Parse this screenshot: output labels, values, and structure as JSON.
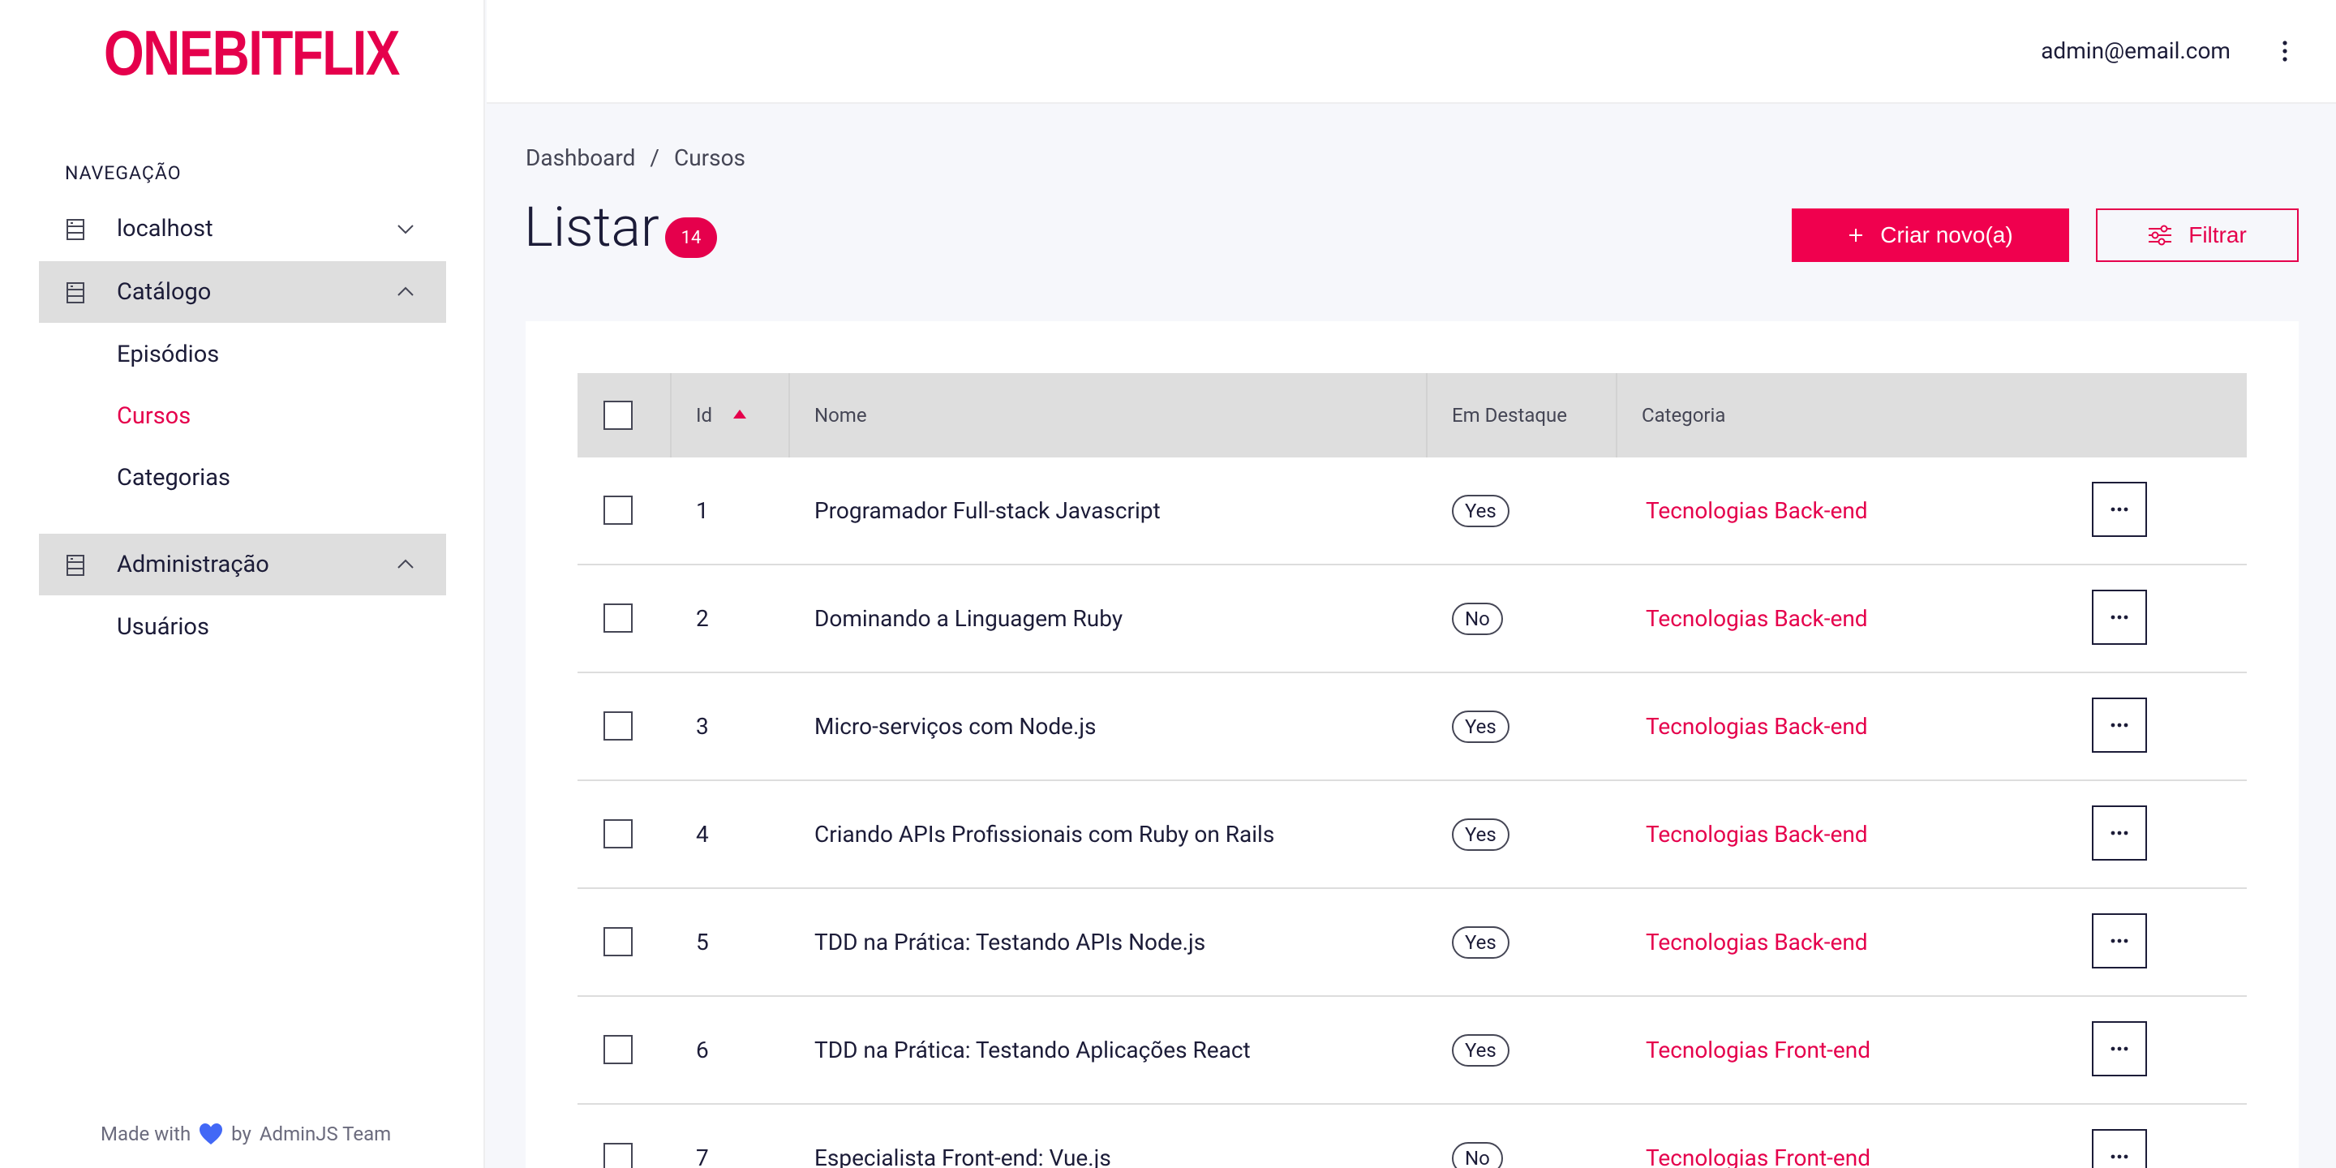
{
  "brand": {
    "logo_text": "ONEBITFLIX",
    "accent_color": "#e5004c"
  },
  "sidebar": {
    "heading": "NAVEGAÇÃO",
    "groups": [
      {
        "label": "localhost",
        "icon": "database-icon",
        "expanded": false,
        "items": []
      },
      {
        "label": "Catálogo",
        "icon": "database-icon",
        "expanded": true,
        "items": [
          "Episódios",
          "Cursos",
          "Categorias"
        ],
        "selected": "Cursos"
      },
      {
        "label": "Administração",
        "icon": "database-icon",
        "expanded": true,
        "items": [
          "Usuários"
        ]
      }
    ],
    "footer": {
      "made_with": "Made with",
      "by": "by",
      "team": "AdminJS Team",
      "heart_color": "#4268f6"
    }
  },
  "topbar": {
    "user_email": "admin@email.com"
  },
  "breadcrumb": [
    "Dashboard",
    "/",
    "Cursos"
  ],
  "page": {
    "title": "Listar",
    "count": "14"
  },
  "actions": {
    "create_label": "Criar novo(a)",
    "filter_label": "Filtrar"
  },
  "table": {
    "columns": {
      "id": "Id",
      "nome": "Nome",
      "destaque": "Em Destaque",
      "categoria": "Categoria"
    },
    "sort": {
      "column": "Id",
      "direction": "asc"
    },
    "rows": [
      {
        "id": "1",
        "nome": "Programador Full-stack Javascript",
        "destaque": "Yes",
        "categoria": "Tecnologias Back-end"
      },
      {
        "id": "2",
        "nome": "Dominando a Linguagem Ruby",
        "destaque": "No",
        "categoria": "Tecnologias Back-end"
      },
      {
        "id": "3",
        "nome": "Micro-serviços com Node.js",
        "destaque": "Yes",
        "categoria": "Tecnologias Back-end"
      },
      {
        "id": "4",
        "nome": "Criando APIs Profissionais com Ruby on Rails",
        "destaque": "Yes",
        "categoria": "Tecnologias Back-end"
      },
      {
        "id": "5",
        "nome": "TDD na Prática: Testando APIs Node.js",
        "destaque": "Yes",
        "categoria": "Tecnologias Back-end"
      },
      {
        "id": "6",
        "nome": "TDD na Prática: Testando Aplicações React",
        "destaque": "Yes",
        "categoria": "Tecnologias Front-end"
      },
      {
        "id": "7",
        "nome": "Especialista Front-end: Vue.js",
        "destaque": "No",
        "categoria": "Tecnologias Front-end"
      }
    ]
  }
}
